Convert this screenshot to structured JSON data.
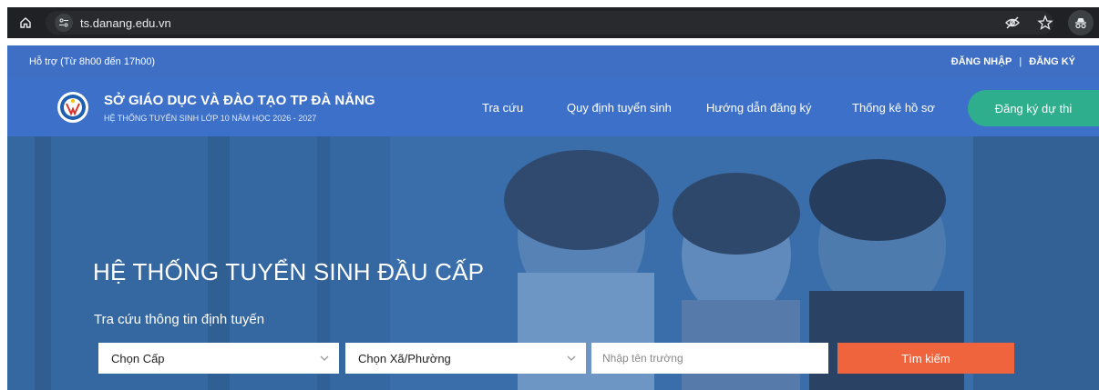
{
  "browser": {
    "url": "ts.danang.edu.vn",
    "icons": [
      "home-icon",
      "site-info-icon",
      "eye-off-icon",
      "star-icon",
      "incognito-icon"
    ]
  },
  "topbar": {
    "support": "Hỗ trợ (Từ 8h00 đến 17h00)",
    "login": "ĐĂNG NHẬP",
    "separator": "|",
    "register": "ĐĂNG KÝ"
  },
  "nav": {
    "title": "SỞ GIÁO DỤC VÀ ĐÀO TẠO TP ĐÀ NẴNG",
    "subtitle": "HỆ THỐNG TUYỂN SINH LỚP 10 NĂM HỌC 2026 - 2027",
    "items": [
      "Tra cứu",
      "Quy định tuyển sinh",
      "Hướng dẫn đăng ký",
      "Thống kê hồ sơ"
    ],
    "cta": "Đăng ký dự thi"
  },
  "hero": {
    "title": "HỆ THỐNG TUYỂN SINH ĐẦU CẤP",
    "subtitle": "Tra cứu thông tin định tuyến",
    "select_level": "Chọn Cấp",
    "select_ward": "Chọn Xã/Phường",
    "school_placeholder": "Nhập tên trường",
    "search_button": "Tìm kiếm"
  },
  "colors": {
    "chrome": "#202124",
    "primary": "#3d70c8",
    "cta": "#2fae8e",
    "search": "#f0643d"
  }
}
